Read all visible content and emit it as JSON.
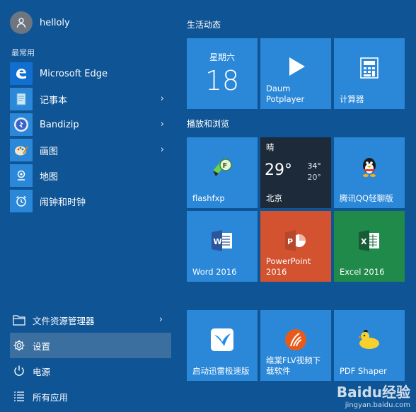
{
  "user": {
    "name": "helloly"
  },
  "most_used_label": "最常用",
  "apps": [
    {
      "label": "Microsoft Edge",
      "icon": "edge-icon",
      "has_arrow": false
    },
    {
      "label": "记事本",
      "icon": "notepad-icon",
      "has_arrow": true
    },
    {
      "label": "Bandizip",
      "icon": "bandizip-icon",
      "has_arrow": true
    },
    {
      "label": "画图",
      "icon": "paint-icon",
      "has_arrow": true
    },
    {
      "label": "地图",
      "icon": "maps-icon",
      "has_arrow": false
    },
    {
      "label": "闹钟和时钟",
      "icon": "alarm-clock-icon",
      "has_arrow": false
    }
  ],
  "bottom": [
    {
      "label": "文件资源管理器",
      "icon": "folder-icon",
      "has_arrow": true
    },
    {
      "label": "设置",
      "icon": "gear-icon",
      "active": true
    },
    {
      "label": "电源",
      "icon": "power-icon"
    },
    {
      "label": "所有应用",
      "icon": "all-apps-icon"
    }
  ],
  "groups": {
    "g1": "生活动态",
    "g2": "播放和浏览"
  },
  "tiles": {
    "calendar": {
      "day": "星期六",
      "date": "18"
    },
    "daum": {
      "label": "Daum\nPotplayer"
    },
    "calc": {
      "label": "计算器"
    },
    "flashfxp": {
      "label": "flashfxp"
    },
    "weather": {
      "cond": "晴",
      "temp": "29°",
      "hi": "34°",
      "lo": "20°",
      "city": "北京"
    },
    "qq": {
      "label": "腾讯QQ轻聊版"
    },
    "word": {
      "label": "Word 2016"
    },
    "powerpoint": {
      "label": "PowerPoint\n2016"
    },
    "excel": {
      "label": "Excel 2016"
    },
    "xunlei": {
      "label": "启动迅雷极速版"
    },
    "flv": {
      "label": "维棠FLV视频下\n载软件"
    },
    "pdf": {
      "label": "PDF Shaper"
    }
  },
  "watermark": {
    "logo": "Baidu经验",
    "url": "jingyan.baidu.com"
  },
  "colors": {
    "background": "#0f5495",
    "tile": "#2b88d8",
    "powerpoint": "#d35230",
    "excel": "#1f8a49",
    "weather": "#1d2a3a"
  }
}
